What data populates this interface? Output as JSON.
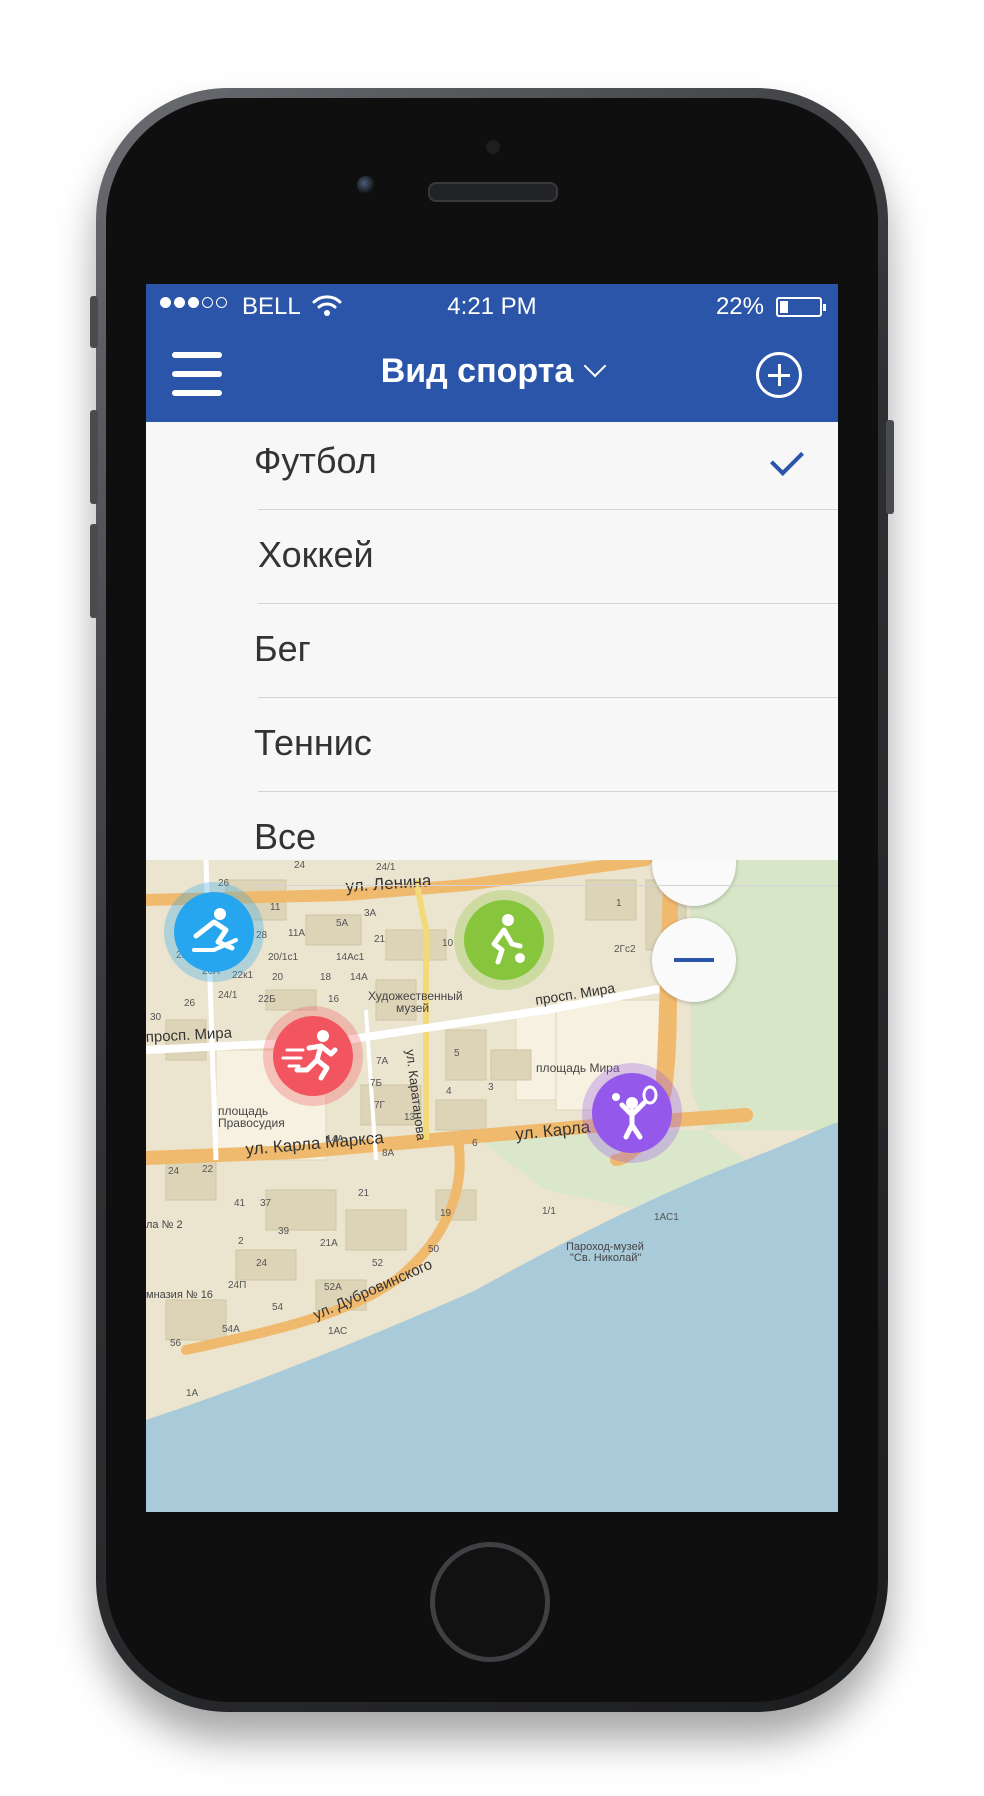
{
  "status_bar": {
    "carrier": "BELL",
    "time": "4:21 PM",
    "battery_percent": "22%",
    "battery_level": 0.22,
    "signal_bars": 3,
    "signal_total": 5
  },
  "nav": {
    "title": "Вид спорта",
    "menu_icon": "hamburger-icon",
    "add_icon": "plus-circle-icon"
  },
  "dropdown": {
    "items": [
      {
        "label": "Футбол",
        "selected": true
      },
      {
        "label": "Хоккей",
        "selected": false
      },
      {
        "label": "Бег",
        "selected": false
      },
      {
        "label": "Теннис",
        "selected": false
      },
      {
        "label": "Все",
        "selected": false
      }
    ]
  },
  "map": {
    "streets": {
      "lenina": "ул. Ленина",
      "mira_right": "просп. Мира",
      "mira_left": "просп. Мира",
      "karatanova": "ул. Каратанова",
      "marksa_left": "ул. Карла Маркса",
      "marksa_right": "ул. Карла Маркса",
      "dubrovinskogo": "ул. Дубровинского"
    },
    "places": {
      "museum_1": "Художественный",
      "museum_2": "музей",
      "square_mira": "площадь Мира",
      "square_prav_1": "площадь",
      "square_prav_2": "Правосудия",
      "steamboat_1": "Пароход-музей",
      "steamboat_2": "\"Св. Николай\"",
      "school_2": "ла № 2",
      "gymnasium": "мназия № 16"
    },
    "house_numbers": [
      "24",
      "24/1",
      "26",
      "11",
      "5А",
      "3А",
      "21",
      "10",
      "2Гс2",
      "28",
      "11А",
      "20/1с1",
      "14Ас1",
      "26А",
      "22к1",
      "20",
      "18",
      "14А",
      "24/1",
      "22Б",
      "16",
      "26",
      "30",
      "7А",
      "7Б",
      "7Г",
      "5",
      "4",
      "3",
      "13",
      "6",
      "14А",
      "8А",
      "24",
      "22",
      "41",
      "37",
      "21",
      "19",
      "1/1",
      "1АС1",
      "39",
      "2",
      "21А",
      "50",
      "24",
      "52",
      "24П",
      "52А",
      "54",
      "54А",
      "1АС",
      "56",
      "1А",
      "23",
      "1"
    ],
    "pins": [
      {
        "sport": "hockey-icon",
        "color": "#27a6f0"
      },
      {
        "sport": "football-icon",
        "color": "#87c53c"
      },
      {
        "sport": "running-icon",
        "color": "#f25560"
      },
      {
        "sport": "tennis-icon",
        "color": "#9458ea"
      }
    ],
    "zoom_out_icon": "minus-icon",
    "zoom_in_icon": "plus-icon"
  }
}
